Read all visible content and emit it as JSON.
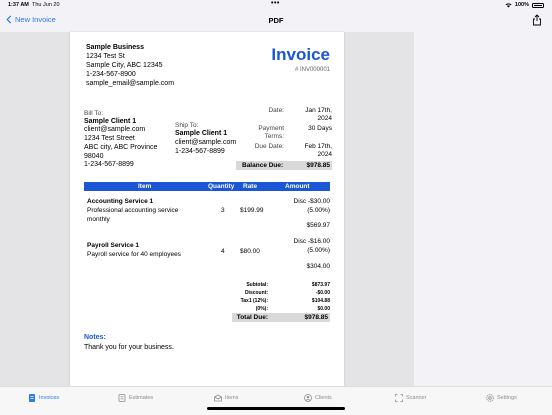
{
  "status_bar": {
    "time": "1:37 AM",
    "date": "Thu Jun 20",
    "battery": "100%"
  },
  "nav": {
    "back_label": "New Invoice",
    "title": "PDF"
  },
  "invoice": {
    "business": {
      "name": "Sample Business",
      "address1": "1234 Test St",
      "address2": "Sample City, ABC 12345",
      "phone": "1-234-567-8900",
      "email": "sample_email@sample.com"
    },
    "title": "Invoice",
    "number": "# INV000001",
    "bill_to": {
      "label": "Bill To:",
      "name": "Sample Client 1",
      "email": "client@sample.com",
      "address1": "1234 Test Street",
      "address2": "ABC city, ABC Province",
      "postal": "98040",
      "phone": "1-234-567-8899"
    },
    "ship_to": {
      "label": "Ship To:",
      "name": "Sample Client 1",
      "email": "client@sample.com",
      "phone": "1-234-567-8899"
    },
    "meta": {
      "date_label": "Date:",
      "date_line1": "Jan 17th,",
      "date_line2": "2024",
      "terms_label_line1": "Payment",
      "terms_label_line2": "Terms:",
      "terms_value": "30 Days",
      "due_label": "Due Date:",
      "due_line1": "Feb 17th,",
      "due_line2": "2024"
    },
    "balance_due": {
      "label": "Balance Due:",
      "value": "$978.85"
    },
    "table_headers": {
      "item": "Item",
      "quantity": "Quantity",
      "rate": "Rate",
      "amount": "Amount"
    },
    "items": [
      {
        "title": "Accounting Service 1",
        "desc_line1": "Professional accounting service",
        "desc_line2": "monthly",
        "quantity": "3",
        "rate": "$199.99",
        "disc_line1": "Disc -$30.00",
        "disc_line2": "(5.00%)",
        "amount": "$569.97"
      },
      {
        "title": "Payroll Service 1",
        "desc_line1": "Payroll service for 40 employees",
        "desc_line2": "",
        "quantity": "4",
        "rate": "$80.00",
        "disc_line1": "Disc -$16.00",
        "disc_line2": "(5.00%)",
        "amount": "$304.00"
      }
    ],
    "totals": {
      "subtotal_label": "Subtotal:",
      "subtotal": "$873.97",
      "discount_label": "Discount:",
      "discount": "-$0.00",
      "tax1_label": "Tax1 (12%):",
      "tax1": "$104.88",
      "tax0_label": "(0%):",
      "tax0": "$0.00",
      "total_due_label": "Total Due:",
      "total_due": "$978.85"
    },
    "notes": {
      "label": "Notes:",
      "text": "Thank you for your business."
    }
  },
  "tabs": [
    {
      "label": "Invoices",
      "icon": "invoice-icon",
      "active": true
    },
    {
      "label": "Estimates",
      "icon": "estimate-icon",
      "active": false
    },
    {
      "label": "Items",
      "icon": "items-icon",
      "active": false
    },
    {
      "label": "Clients",
      "icon": "clients-icon",
      "active": false
    },
    {
      "label": "Scanner",
      "icon": "scanner-icon",
      "active": false
    },
    {
      "label": "Settings",
      "icon": "gear-icon",
      "active": false
    }
  ],
  "colors": {
    "accent": "#2a7af0",
    "invoice_blue": "#1a56d6"
  }
}
